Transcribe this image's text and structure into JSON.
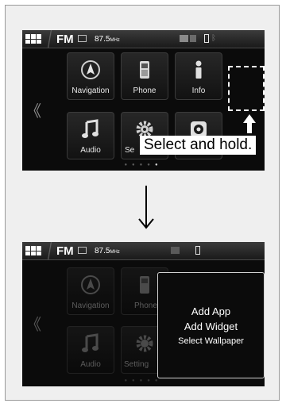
{
  "top_screen": {
    "status": {
      "band": "FM",
      "frequency": "87.5",
      "freq_unit": "MHz"
    },
    "tiles": [
      {
        "label": "Navigation",
        "icon": "compass-icon"
      },
      {
        "label": "Phone",
        "icon": "phone-icon"
      },
      {
        "label": "Info",
        "icon": "info-icon"
      },
      {
        "label": "Audio",
        "icon": "music-note-icon"
      },
      {
        "label": "Se",
        "icon": "gear-icon"
      },
      {
        "label": "",
        "icon": "media-icon"
      }
    ],
    "callout": "Select and hold."
  },
  "bottom_screen": {
    "status": {
      "band": "FM",
      "frequency": "87.5",
      "freq_unit": "MHz"
    },
    "tiles": [
      {
        "label": "Navigation",
        "icon": "compass-icon"
      },
      {
        "label": "Phone",
        "icon": "phone-icon"
      },
      {
        "label": "Audio",
        "icon": "music-note-icon"
      },
      {
        "label": "Setting",
        "icon": "gear-icon"
      }
    ],
    "menu": {
      "add_app": "Add App",
      "add_widget": "Add Widget",
      "select_wallpaper": "Select Wallpaper"
    }
  },
  "colors": {
    "screen_bg": "#0b0b0b",
    "text": "#ffffff",
    "dim_text": "#5c5c5c"
  }
}
